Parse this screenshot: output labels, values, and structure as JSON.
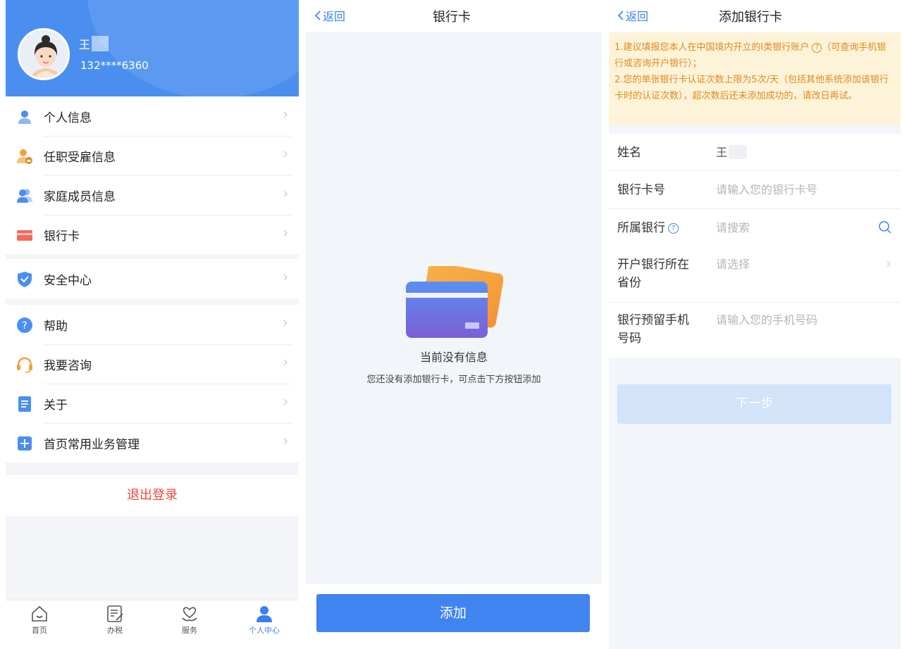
{
  "profile": {
    "name": "王",
    "phone": "132****6360"
  },
  "menu": {
    "group1": [
      {
        "label": "个人信息",
        "icon": "person-icon"
      },
      {
        "label": "任职受雇信息",
        "icon": "employment-icon"
      },
      {
        "label": "家庭成员信息",
        "icon": "family-icon"
      },
      {
        "label": "银行卡",
        "icon": "bank-card-icon"
      }
    ],
    "group2": [
      {
        "label": "安全中心",
        "icon": "shield-icon"
      }
    ],
    "group3": [
      {
        "label": "帮助",
        "icon": "help-icon"
      },
      {
        "label": "我要咨询",
        "icon": "headset-icon"
      },
      {
        "label": "关于",
        "icon": "document-icon"
      },
      {
        "label": "首页常用业务管理",
        "icon": "plus-square-icon"
      }
    ]
  },
  "logout_label": "退出登录",
  "tabbar": {
    "tabs": [
      {
        "label": "首页",
        "icon": "home-icon"
      },
      {
        "label": "办税",
        "icon": "tax-form-icon"
      },
      {
        "label": "服务",
        "icon": "heart-hand-icon"
      },
      {
        "label": "个人中心",
        "icon": "user-icon"
      }
    ],
    "active_index": 3
  },
  "bank_card_page": {
    "back_label": "返回",
    "title": "银行卡",
    "empty_title": "当前没有信息",
    "empty_desc": "您还没有添加银行卡，可点击下方按钮添加",
    "add_label": "添加"
  },
  "add_bank_card_page": {
    "back_label": "返回",
    "title": "添加银行卡",
    "notice_line1a": "1.建议填报您本人在中国境内开立的Ⅰ类银行账户",
    "notice_line1b": "（可查询手机银行或咨询开户银行）；",
    "notice_line2": "2.您的单张银行卡认证次数上限为5次/天（包括其他系统添加该银行卡时的认证次数），超次数后还未添加成功的，请改日再试。",
    "fields": {
      "name": {
        "label": "姓名",
        "value": "王"
      },
      "card_number": {
        "label": "银行卡号",
        "placeholder": "请输入您的银行卡号"
      },
      "bank": {
        "label": "所属银行",
        "placeholder": "请搜索"
      },
      "province": {
        "label_line1": "开户银行所在",
        "label_line2": "省份",
        "placeholder": "请选择"
      },
      "phone": {
        "label_line1": "银行预留手机",
        "label_line2": "号码",
        "placeholder": "请输入您的手机号码"
      }
    },
    "next_label": "下一步"
  },
  "colors": {
    "primary": "#3f84ef",
    "header_blue": "#4a8ff0",
    "logout_red": "#e84a3f",
    "notice_bg": "#fdf3d9",
    "notice_text": "#e08a1e",
    "disabled_button": "#d2e3fa"
  }
}
